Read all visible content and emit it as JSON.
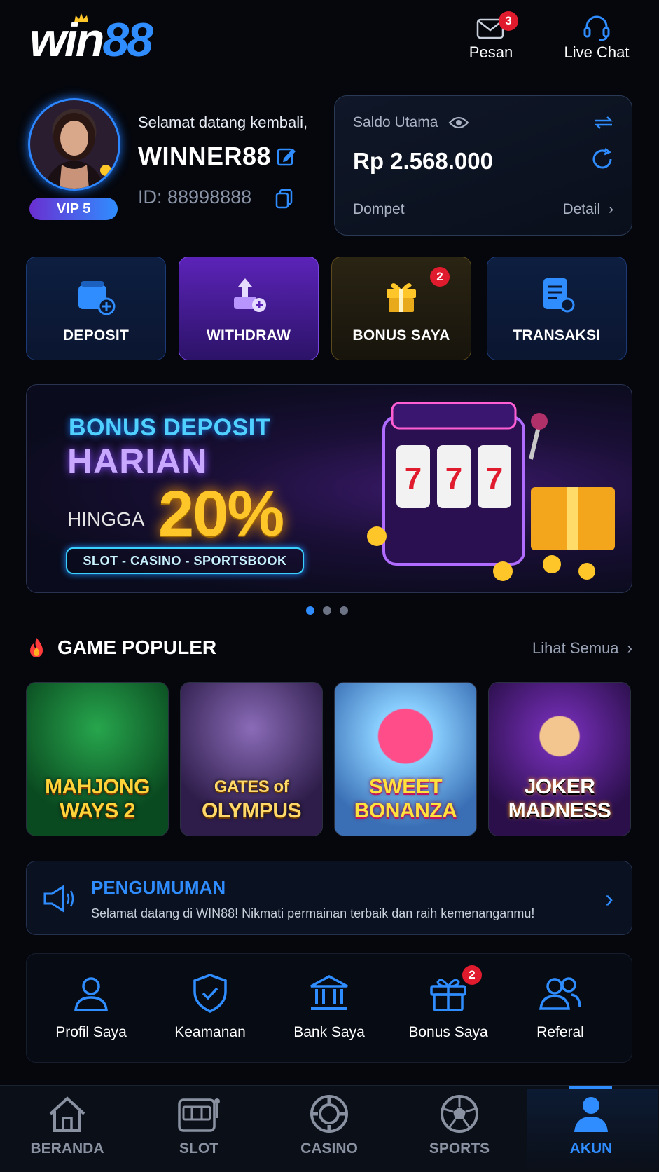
{
  "header": {
    "logo_text_white": "win",
    "logo_text_blue": "88",
    "messages_label": "Pesan",
    "messages_count": "3",
    "livechat_label": "Live Chat"
  },
  "profile": {
    "welcome": "Selamat datang kembali,",
    "username": "WINNER88",
    "user_id": "ID: 88998888",
    "vip": "VIP 5"
  },
  "balance": {
    "label": "Saldo Utama",
    "amount": "Rp 2.568.000",
    "wallet_label": "Dompet",
    "detail_label": "Detail"
  },
  "quick_actions": [
    {
      "label": "DEPOSIT"
    },
    {
      "label": "WITHDRAW"
    },
    {
      "label": "BONUS SAYA",
      "badge": "2"
    },
    {
      "label": "TRANSAKSI"
    }
  ],
  "banner": {
    "line1": "BONUS DEPOSIT",
    "line2": "HARIAN",
    "hingga": "HINGGA",
    "percent": "20%",
    "categories": "SLOT - CASINO - SPORTSBOOK",
    "slot_reels": [
      "7",
      "7",
      "7"
    ]
  },
  "popular": {
    "title": "GAME POPULER",
    "see_all": "Lihat Semua",
    "games": [
      {
        "line1": "MAHJONG",
        "line2": "WAYS 2"
      },
      {
        "line1": "GATES of",
        "line2": "OLYMPUS"
      },
      {
        "line1": "SWEET",
        "line2": "BONANZA"
      },
      {
        "line1": "JOKER",
        "line2": "MADNESS"
      }
    ]
  },
  "announcement": {
    "title": "PENGUMUMAN",
    "text": "Selamat datang di WIN88! Nikmati permainan terbaik dan raih kemenanganmu!"
  },
  "menu": [
    {
      "label": "Profil Saya",
      "icon": "user-icon"
    },
    {
      "label": "Keamanan",
      "icon": "shield-check-icon"
    },
    {
      "label": "Bank Saya",
      "icon": "bank-icon"
    },
    {
      "label": "Bonus Saya",
      "icon": "gift-icon",
      "badge": "2"
    },
    {
      "label": "Referal",
      "icon": "users-icon"
    }
  ],
  "bottom_nav": [
    {
      "label": "BERANDA",
      "icon": "home-icon"
    },
    {
      "label": "SLOT",
      "icon": "slot-machine-icon"
    },
    {
      "label": "CASINO",
      "icon": "casino-chip-icon"
    },
    {
      "label": "SPORTS",
      "icon": "soccer-ball-icon"
    },
    {
      "label": "AKUN",
      "icon": "account-icon",
      "active": true
    }
  ],
  "colors": {
    "accent": "#2f8dff",
    "badge": "#e01b2d",
    "gold": "#ffc629",
    "background": "#05070d"
  }
}
